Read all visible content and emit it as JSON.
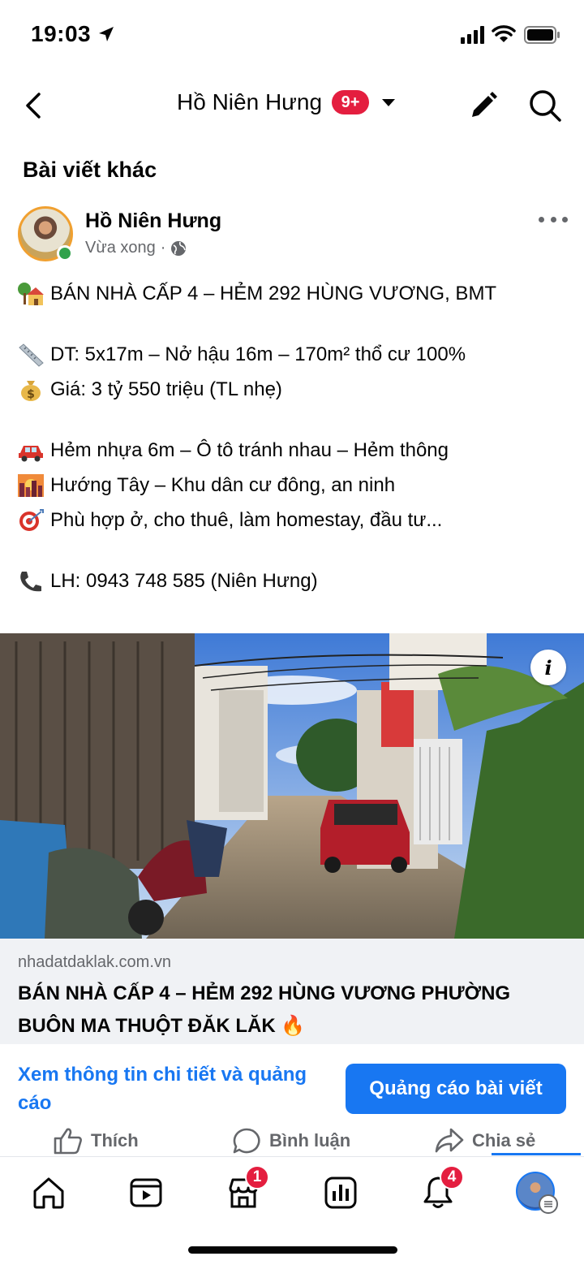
{
  "status_bar": {
    "time": "19:03"
  },
  "header": {
    "title": "Hồ Niên Hưng",
    "badge": "9+"
  },
  "section_title": "Bài viết khác",
  "post": {
    "author": "Hồ Niên Hưng",
    "time": "Vừa xong",
    "separator": "·",
    "lines": {
      "title": "BÁN NHÀ CẤP 4 – HẺM 292 HÙNG VƯƠNG, BMT",
      "area": "DT: 5x17m – Nở hậu 16m – 170m² thổ cư 100%",
      "price": "Giá: 3 tỷ 550 triệu (TL nhẹ)",
      "road": "Hẻm nhựa 6m – Ô tô tránh nhau – Hẻm thông",
      "direction": "Hướng Tây – Khu dân cư đông, an ninh",
      "purpose": "Phù hợp ở, cho thuê, làm homestay, đầu tư...",
      "contact": "LH: 0943 748 585 (Niên Hưng)"
    },
    "emojis": [
      "house-with-garden",
      "straight-ruler",
      "money-bag",
      "car",
      "cityscape-sunset",
      "target",
      "telephone"
    ]
  },
  "photo": {
    "info_label": "i"
  },
  "link_preview": {
    "domain": "nhadatdaklak.com.vn",
    "title": "BÁN NHÀ CẤP 4 – HẺM 292 HÙNG VƯƠNG PHƯỜNG BUÔN MA THUỘT ĐĂK LĂK 🔥"
  },
  "cta": {
    "details_link": "Xem thông tin chi tiết và quảng cáo",
    "boost_button": "Quảng cáo bài viết"
  },
  "actions": {
    "like": "Thích",
    "comment": "Bình luận",
    "share": "Chia sẻ"
  },
  "bottom_nav": {
    "marketplace_badge": "1",
    "notifications_badge": "4"
  },
  "colors": {
    "accent": "#1877f2",
    "badge": "#e41e3f",
    "muted": "#65676b",
    "online": "#31a24c"
  }
}
